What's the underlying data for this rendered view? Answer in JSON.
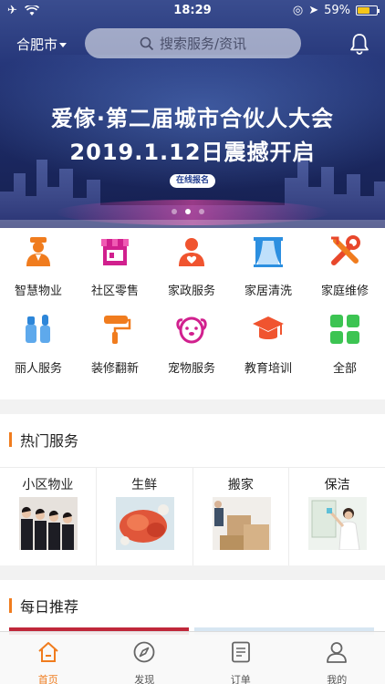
{
  "status": {
    "time": "18:29",
    "battery": "59%",
    "battery_level": 0.59
  },
  "header": {
    "city": "合肥市",
    "search_placeholder": "搜索服务/资讯"
  },
  "banner": {
    "line1": "爱傢·第二届城市合伙人大会",
    "line2": "2019.1.12日震撼开启",
    "button": "在线报名",
    "slide_count": 3,
    "active_slide": 2
  },
  "categories": [
    {
      "label": "智慧物业",
      "icon": "property-staff-icon"
    },
    {
      "label": "社区零售",
      "icon": "shop-icon"
    },
    {
      "label": "家政服务",
      "icon": "housekeeping-icon"
    },
    {
      "label": "家居清洗",
      "icon": "window-cleaning-icon"
    },
    {
      "label": "家庭维修",
      "icon": "repair-tools-icon"
    },
    {
      "label": "丽人服务",
      "icon": "beauty-icon"
    },
    {
      "label": "装修翻新",
      "icon": "paint-roller-icon"
    },
    {
      "label": "宠物服务",
      "icon": "pet-icon"
    },
    {
      "label": "教育培训",
      "icon": "graduation-cap-icon"
    },
    {
      "label": "全部",
      "icon": "all-grid-icon"
    }
  ],
  "hot": {
    "title": "热门服务",
    "items": [
      {
        "label": "小区物业"
      },
      {
        "label": "生鲜"
      },
      {
        "label": "搬家"
      },
      {
        "label": "保洁"
      }
    ]
  },
  "daily": {
    "title": "每日推荐"
  },
  "tabbar": {
    "items": [
      {
        "label": "首页",
        "icon": "home-icon"
      },
      {
        "label": "发现",
        "icon": "compass-icon"
      },
      {
        "label": "订单",
        "icon": "order-icon"
      },
      {
        "label": "我的",
        "icon": "user-icon"
      }
    ],
    "active": 0
  },
  "colors": {
    "accent": "#f07c1e",
    "banner_dark": "#1d2b66"
  }
}
